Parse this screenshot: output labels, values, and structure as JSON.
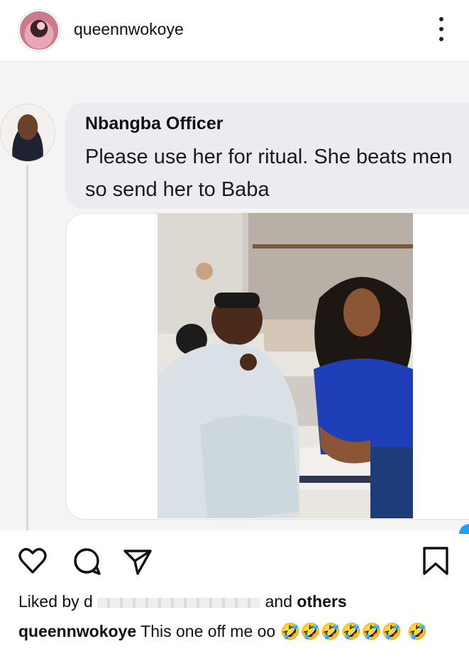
{
  "header": {
    "username": "queennwokoye"
  },
  "comment": {
    "author": "Nbangba Officer",
    "text": "Please use her for ritual. She beats men so send her to Baba"
  },
  "likes": {
    "prefix": "Liked by d",
    "suffix": "and",
    "others": "others"
  },
  "caption": {
    "username": "queennwokoye",
    "text": "This one off me oo",
    "emojis": "🤣🤣🤣🤣🤣🤣 🤣"
  },
  "icons": {
    "more": "more-vertical-icon",
    "like": "heart-icon",
    "comment": "comment-icon",
    "share": "send-icon",
    "save": "bookmark-icon"
  }
}
